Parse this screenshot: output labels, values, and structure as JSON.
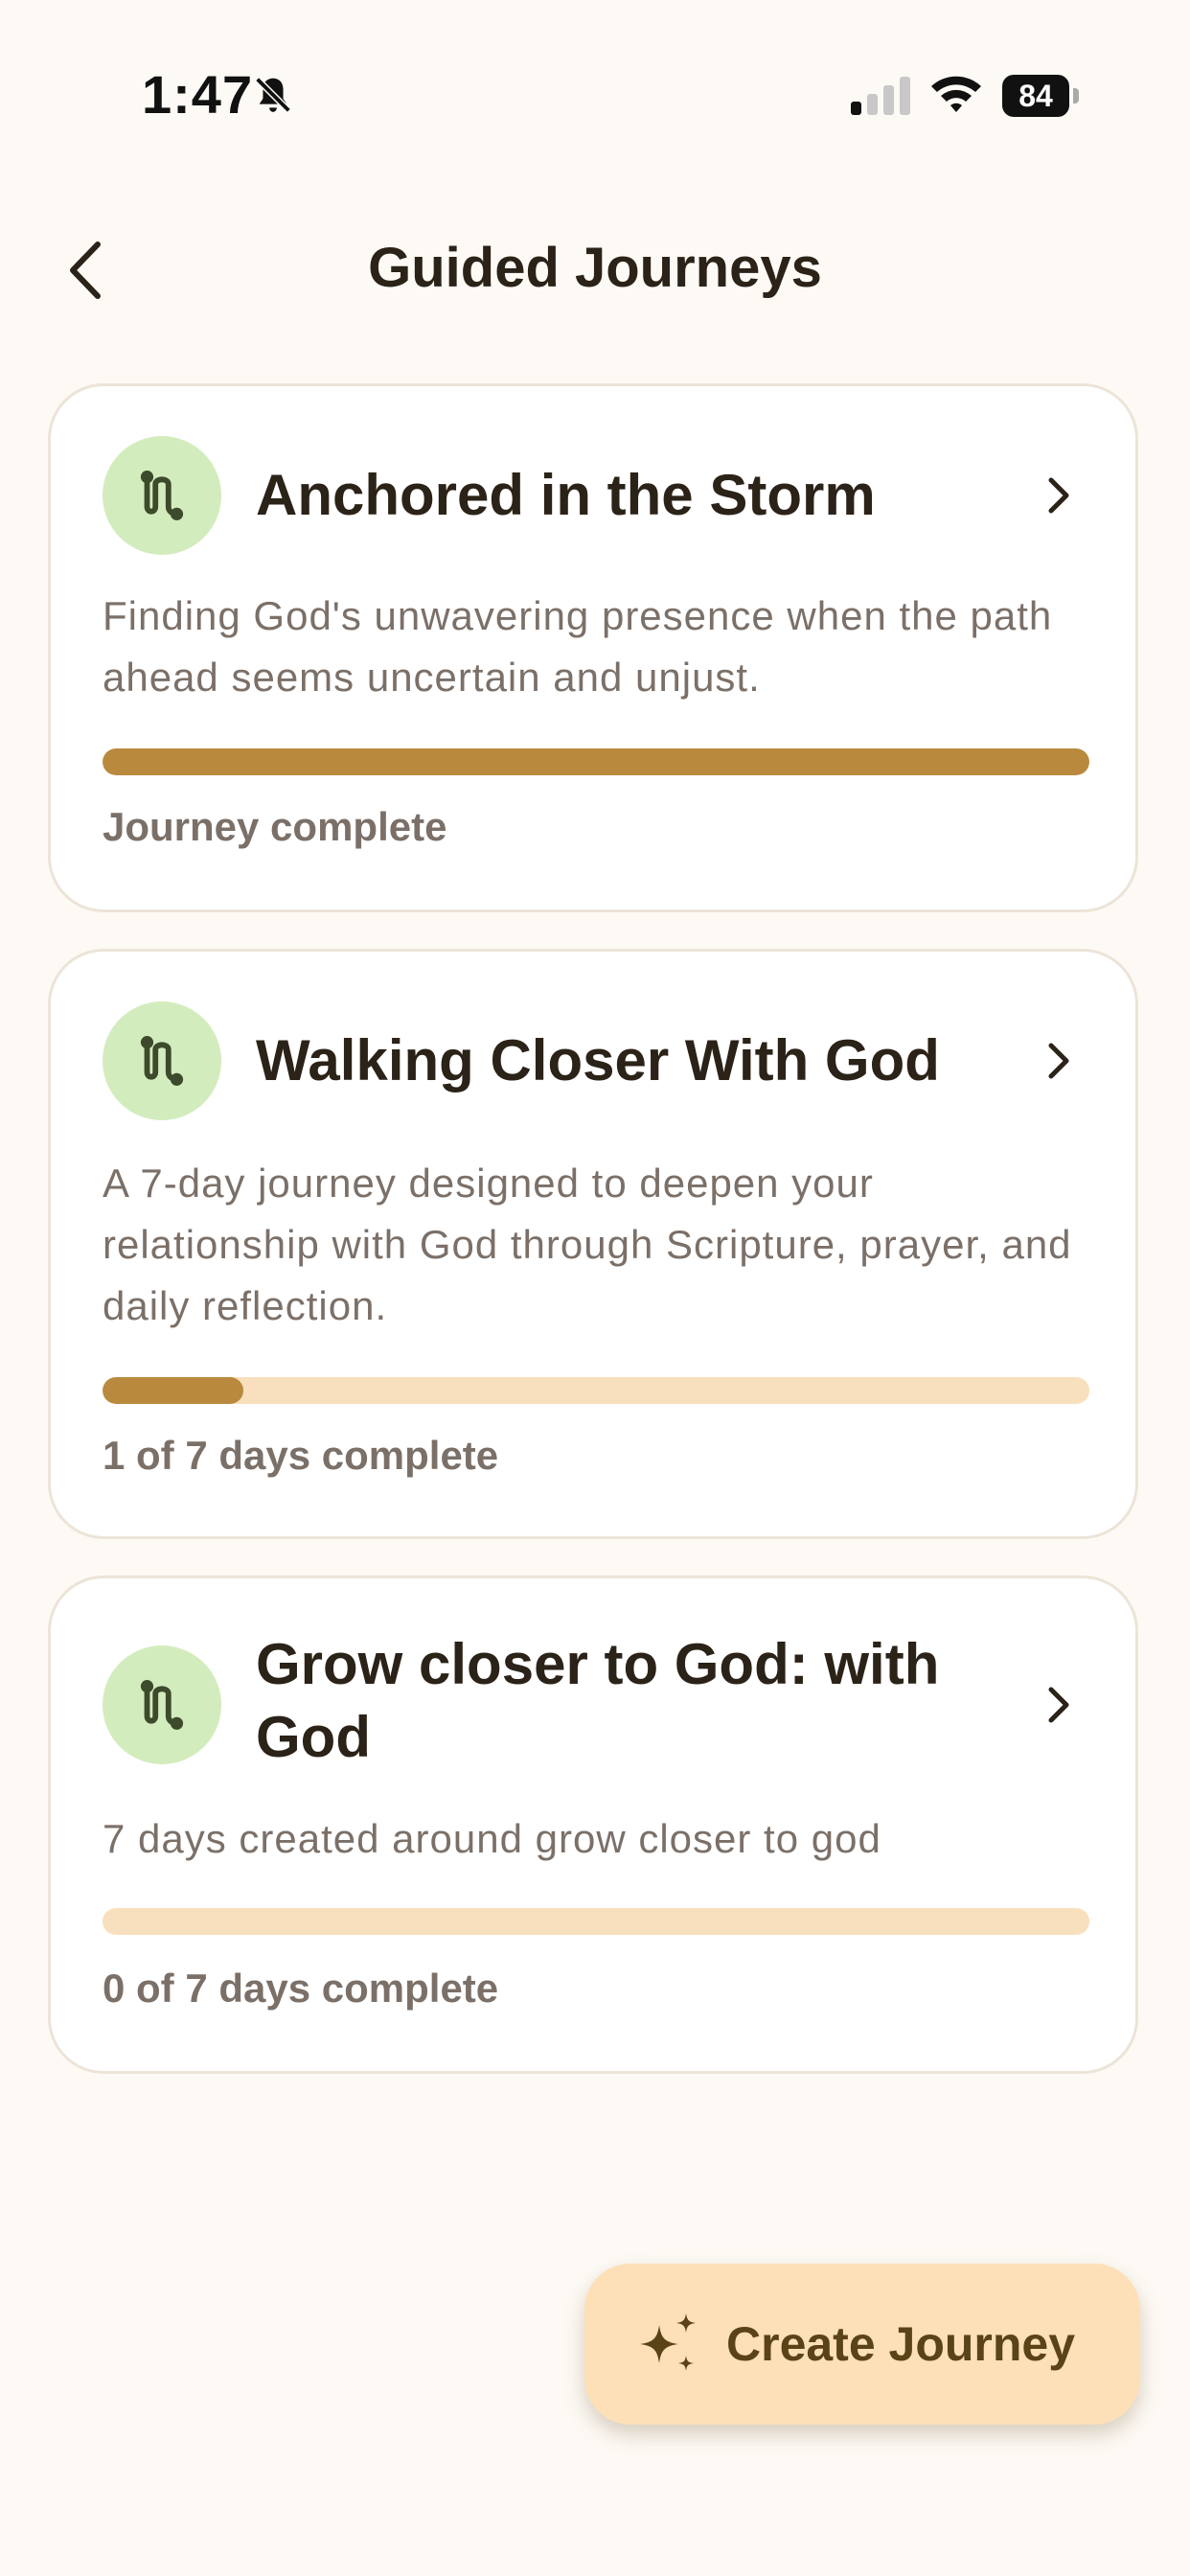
{
  "status_bar": {
    "time": "1:47",
    "battery": "84"
  },
  "header": {
    "title": "Guided Journeys"
  },
  "journeys": [
    {
      "title": "Anchored in the Storm",
      "description": "Finding God's unwavering presence when the path ahead seems uncertain and unjust.",
      "progress_label": "Journey complete",
      "progress": 1.0
    },
    {
      "title": "Walking Closer With God",
      "description": "A 7-day journey designed to deepen your relationship with God through Scripture, prayer, and daily reflection.",
      "progress_label": "1 of 7 days complete",
      "progress": 0.143
    },
    {
      "title": "Grow closer to God: with God",
      "description": "7 days created around grow closer to god",
      "progress_label": "0 of 7 days complete",
      "progress": 0.0
    }
  ],
  "create_button": {
    "label": "Create Journey"
  },
  "colors": {
    "accent": "#b98a3e",
    "track": "#f8dfbd",
    "icon_bg": "#d3ecbd",
    "button_bg": "#fde0b8"
  }
}
